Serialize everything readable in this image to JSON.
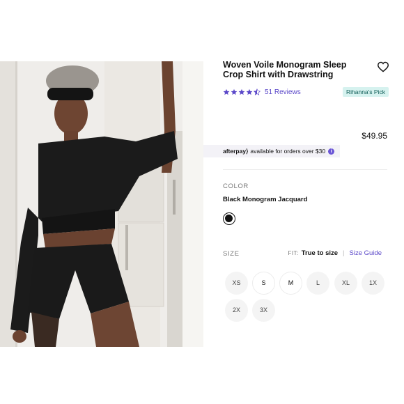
{
  "product": {
    "title": "Woven Voile Monogram Sleep Crop Shirt with Drawstring",
    "reviews": "51 Reviews",
    "rating": 4.5,
    "badge": "Rihanna's Pick",
    "price": "$49.95"
  },
  "afterpay": {
    "logo": "afterpay⟩",
    "text": "available for orders over $30",
    "info": "i"
  },
  "color": {
    "label": "COLOR",
    "selected": "Black Monogram Jacquard",
    "swatch": "#111111"
  },
  "size": {
    "label": "SIZE",
    "fit_prefix": "FIT:",
    "fit_value": "True to size",
    "separator": "|",
    "guide": "Size Guide",
    "options": [
      "XS",
      "S",
      "M",
      "L",
      "XL",
      "1X",
      "2X",
      "3X"
    ]
  },
  "colors": {
    "accent": "#5b48c9",
    "badge_bg": "#d6f2ef",
    "badge_text": "#0c5b55"
  }
}
